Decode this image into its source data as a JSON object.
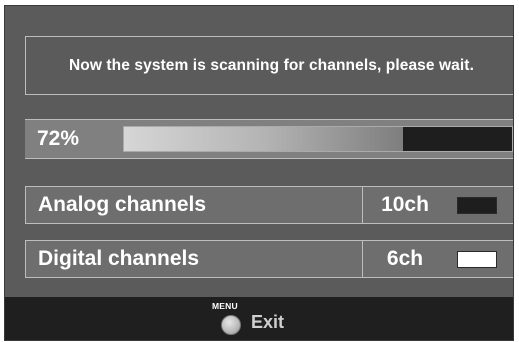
{
  "message": "Now the system is scanning for channels, please wait.",
  "progress": {
    "label": "72%",
    "fraction": 0.72
  },
  "channels": [
    {
      "label": "Analog channels",
      "count": "10ch",
      "indicator_color": "#1e1e1e"
    },
    {
      "label": "Digital channels",
      "count": "6ch",
      "indicator_color": "#ffffff"
    }
  ],
  "footer": {
    "menu_caption": "MENU",
    "menu_icon": "round-menu-button-icon",
    "exit_label": "Exit"
  },
  "colors": {
    "panel_background": "#5b5b5b",
    "footer_background": "#1f1f1f",
    "progress_track": "#1e1e1e"
  }
}
